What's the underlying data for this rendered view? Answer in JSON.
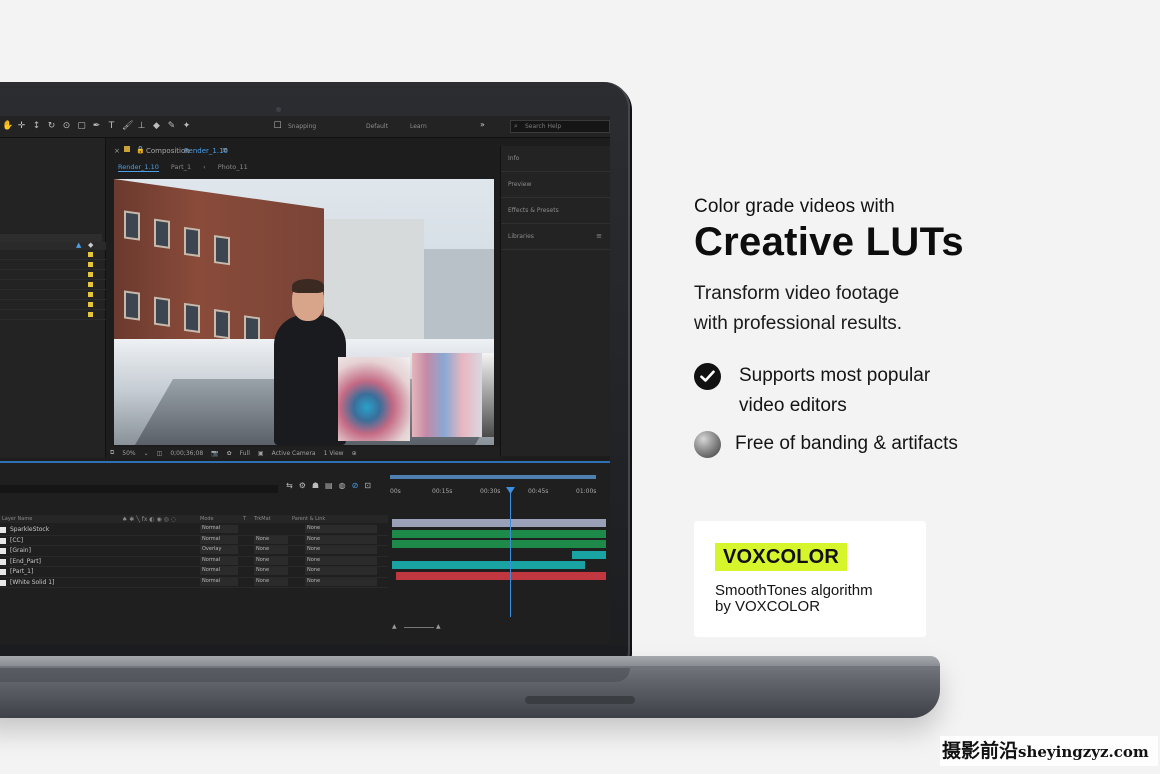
{
  "app": {
    "toolbar": {
      "snapping_label": "Snapping",
      "workspace_default": "Default",
      "workspace_learn": "Learn",
      "search_placeholder": "Search Help"
    },
    "composition": {
      "title": "Composition",
      "comp_name": "Render_1.10",
      "tabs": [
        "Render_1.10",
        "Part_1",
        "Photo_11"
      ]
    },
    "viewer_controls": {
      "zoom": "50%",
      "timecode": "0;00;36;08",
      "resolution": "Full",
      "camera": "Active Camera",
      "views": "1 View"
    },
    "right_panel": {
      "items": [
        "Info",
        "Preview",
        "Effects & Presets",
        "Libraries"
      ]
    },
    "timeline": {
      "ruler": [
        "00s",
        "00:15s",
        "00:30s",
        "00:45s",
        "01:00s"
      ],
      "columns": {
        "layer_name": "Layer Name",
        "mode": "Mode",
        "t": "T",
        "trkmat": "TrkMat",
        "parent": "Parent & Link"
      },
      "layers": [
        {
          "name": "SparkleStock",
          "mode": "Normal",
          "trkmat": "",
          "parent": "None",
          "color": "#9aa0b8"
        },
        {
          "name": "[CC]",
          "mode": "Normal",
          "trkmat": "None",
          "parent": "None",
          "color": "#1e8a4a"
        },
        {
          "name": "[Grain]",
          "mode": "Overlay",
          "trkmat": "None",
          "parent": "None",
          "color": "#1e8a4a"
        },
        {
          "name": "[End_Part]",
          "mode": "Normal",
          "trkmat": "None",
          "parent": "None",
          "color": "#1aa3a3"
        },
        {
          "name": "[Part_1]",
          "mode": "Normal",
          "trkmat": "None",
          "parent": "None",
          "color": "#1aa3a3"
        },
        {
          "name": "[White Solid 1]",
          "mode": "Normal",
          "trkmat": "None",
          "parent": "None",
          "color": "#c0373f"
        }
      ]
    }
  },
  "copy": {
    "eyebrow": "Color grade videos with",
    "headline": "Creative LUTs",
    "body_line1": "Transform video footage",
    "body_line2": "with professional results.",
    "feature1_line1": "Supports most popular",
    "feature1_line2": "video editors",
    "feature2": "Free of banding & artifacts"
  },
  "card": {
    "brand": "VOXCOLOR",
    "line1": "SmoothTones algorithm",
    "line2": "by VOXCOLOR"
  },
  "watermark": {
    "cn": "摄影前沿",
    "url": "sheyingzyz.com"
  },
  "colors": {
    "brand_accent": "#d6f52b",
    "ae_blue": "#4a9fe8",
    "background": "#f3f3f3"
  },
  "icons": {
    "feature1": "check-circle-icon",
    "feature2": "sphere-icon"
  }
}
